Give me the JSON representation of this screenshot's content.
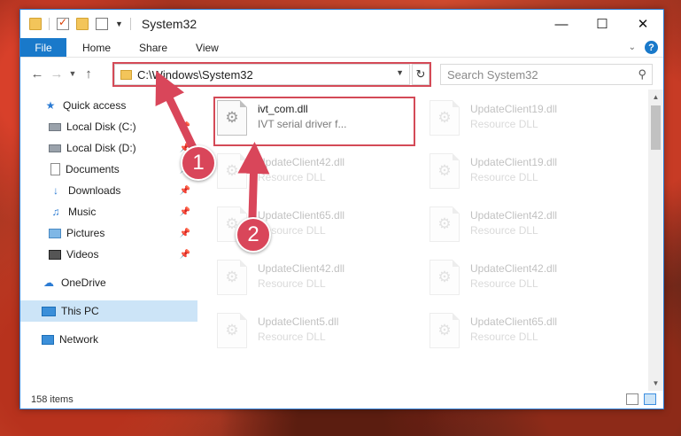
{
  "window": {
    "title": "System32",
    "controls": {
      "minimize": "—",
      "maximize": "☐",
      "close": "✕"
    }
  },
  "ribbon": {
    "tabs": [
      "File",
      "Home",
      "Share",
      "View"
    ]
  },
  "address": {
    "path": "C:\\Windows\\System32",
    "search_placeholder": "Search System32"
  },
  "sidebar": {
    "items": [
      {
        "label": "Quick access",
        "icon": "star-icon",
        "pinned": false
      },
      {
        "label": "Local Disk (C:)",
        "icon": "drive-icon",
        "pinned": true
      },
      {
        "label": "Local Disk (D:)",
        "icon": "drive-icon",
        "pinned": true
      },
      {
        "label": "Documents",
        "icon": "documents-icon",
        "pinned": true
      },
      {
        "label": "Downloads",
        "icon": "download-icon",
        "pinned": true
      },
      {
        "label": "Music",
        "icon": "music-icon",
        "pinned": true
      },
      {
        "label": "Pictures",
        "icon": "pictures-icon",
        "pinned": true
      },
      {
        "label": "Videos",
        "icon": "videos-icon",
        "pinned": true
      },
      {
        "label": "OneDrive",
        "icon": "cloud-icon",
        "pinned": false
      },
      {
        "label": "This PC",
        "icon": "pc-icon",
        "pinned": false,
        "selected": true
      },
      {
        "label": "Network",
        "icon": "network-icon",
        "pinned": false
      }
    ]
  },
  "files": [
    {
      "name": "ivt_com.dll",
      "type": "IVT serial driver f...",
      "highlighted": true
    },
    {
      "name": "UpdateClient42.dll",
      "type": "Resource DLL"
    },
    {
      "name": "UpdateClient65.dll",
      "type": "Resource DLL"
    },
    {
      "name": "UpdateClient42.dll",
      "type": "Resource DLL"
    },
    {
      "name": "UpdateClient5.dll",
      "type": "Resource DLL"
    },
    {
      "name": "UpdateClient19.dll",
      "type": "Resource DLL"
    },
    {
      "name": "UpdateClient19.dll",
      "type": "Resource DLL"
    },
    {
      "name": "UpdateClient42.dll",
      "type": "Resource DLL"
    },
    {
      "name": "UpdateClient42.dll",
      "type": "Resource DLL"
    },
    {
      "name": "UpdateClient65.dll",
      "type": "Resource DLL"
    }
  ],
  "status": {
    "item_count": "158 items"
  },
  "annotations": {
    "step1": "1",
    "step2": "2",
    "color": "#d9465a"
  }
}
